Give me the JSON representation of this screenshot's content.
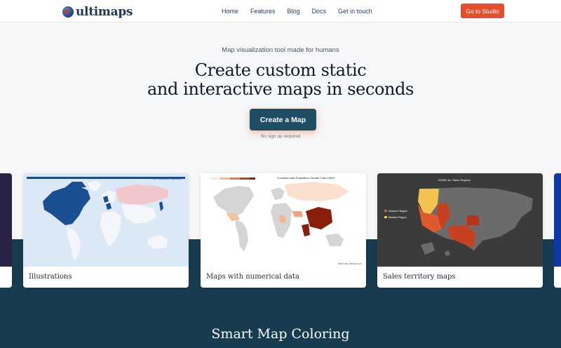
{
  "brand": {
    "name": "ultimaps"
  },
  "nav": {
    "items": [
      {
        "label": "Home"
      },
      {
        "label": "Features"
      },
      {
        "label": "Blog"
      },
      {
        "label": "Docs"
      },
      {
        "label": "Get in touch"
      }
    ],
    "cta_label": "Go to Studio"
  },
  "hero": {
    "tagline": "Map visualization tool made for humans",
    "title_line1": "Create custom static",
    "title_line2": "and interactive maps in seconds",
    "cta_label": "Create a Map",
    "cta_note": "No sign up required"
  },
  "cards": [
    {
      "label": "Illustrations",
      "map_title": "G7 Countries (2024)"
    },
    {
      "label": "Maps with numerical data",
      "map_title": "Countries with Population Greater Than 100M",
      "map_footer": "Made with ultimaps.com"
    },
    {
      "label": "Sales territory maps",
      "map_title": "ACME Inc. Sales Regions",
      "legend": [
        "Southern Region",
        "Western Region"
      ]
    }
  ],
  "section": {
    "title": "Smart Map Coloring"
  },
  "colors": {
    "accent": "#e4502e",
    "primary_dark": "#173b4f",
    "cta_bg": "#1f4d63"
  }
}
